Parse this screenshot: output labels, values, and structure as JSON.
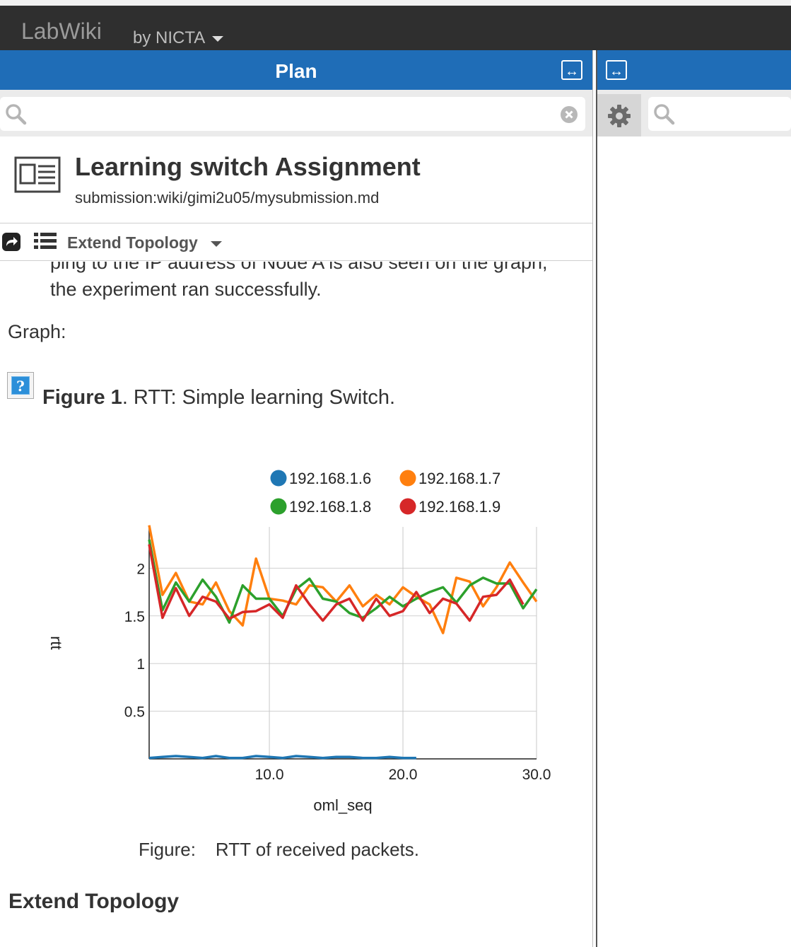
{
  "navbar": {
    "brand": "LabWiki",
    "by_menu": "by NICTA"
  },
  "plan_panel": {
    "title": "Plan",
    "search_placeholder": ""
  },
  "right_panel": {
    "search_placeholder": ""
  },
  "document": {
    "title": "Learning switch Assignment",
    "path": "submission:wiki/gimi2u05/mysubmission.md",
    "section_selector": "Extend Topology"
  },
  "content": {
    "paragraph_tail": "ping to the IP address of Node A is also seen on the graph, the experiment ran successfully.",
    "graph_label": "Graph:",
    "figure_caption_bold": "Figure 1",
    "figure_caption_text": ". RTT: Simple learning Switch.",
    "chart_caption_label": "Figure:",
    "chart_caption_text": "RTT of received packets.",
    "next_heading": "Extend Topology"
  },
  "chart_data": {
    "type": "line",
    "xlabel": "oml_seq",
    "ylabel": "rtt",
    "xlim": [
      1,
      30
    ],
    "ylim": [
      0,
      2.45
    ],
    "x_ticks": [
      "10.0",
      "20.0",
      "30.0"
    ],
    "y_ticks": [
      "0.5",
      "1",
      "1.5",
      "2"
    ],
    "x": [
      1,
      2,
      3,
      4,
      5,
      6,
      7,
      8,
      9,
      10,
      11,
      12,
      13,
      14,
      15,
      16,
      17,
      18,
      19,
      20,
      21,
      22,
      23,
      24,
      25,
      26,
      27,
      28,
      29,
      30
    ],
    "series": [
      {
        "name": "192.168.1.6",
        "color": "#1f77b4",
        "values": [
          0.01,
          0.02,
          0.03,
          0.02,
          0.01,
          0.03,
          0.01,
          0.01,
          0.03,
          0.02,
          0.01,
          0.03,
          0.02,
          0.01,
          0.02,
          0.02,
          0.01,
          0.01,
          0.02,
          0.01,
          0.01
        ]
      },
      {
        "name": "192.168.1.7",
        "color": "#ff7f0e",
        "values": [
          2.45,
          1.72,
          1.95,
          1.65,
          1.62,
          1.85,
          1.55,
          1.4,
          2.1,
          1.68,
          1.66,
          1.62,
          1.82,
          1.8,
          1.65,
          1.82,
          1.6,
          1.72,
          1.62,
          1.8,
          1.7,
          1.62,
          1.32,
          1.9,
          1.86,
          1.6,
          1.8,
          2.06,
          1.85,
          1.65
        ]
      },
      {
        "name": "192.168.1.8",
        "color": "#2ca02c",
        "values": [
          2.3,
          1.56,
          1.85,
          1.65,
          1.88,
          1.7,
          1.43,
          1.82,
          1.68,
          1.68,
          1.5,
          1.78,
          1.89,
          1.68,
          1.65,
          1.53,
          1.48,
          1.58,
          1.7,
          1.6,
          1.68,
          1.75,
          1.8,
          1.64,
          1.82,
          1.9,
          1.84,
          1.84,
          1.58,
          1.78
        ]
      },
      {
        "name": "192.168.1.9",
        "color": "#d62728",
        "values": [
          2.25,
          1.48,
          1.79,
          1.5,
          1.7,
          1.65,
          1.47,
          1.54,
          1.55,
          1.62,
          1.48,
          1.82,
          1.62,
          1.45,
          1.62,
          1.68,
          1.45,
          1.68,
          1.5,
          1.55,
          1.75,
          1.53,
          1.68,
          1.63,
          1.45,
          1.7,
          1.72,
          1.88,
          1.62
        ]
      }
    ]
  }
}
